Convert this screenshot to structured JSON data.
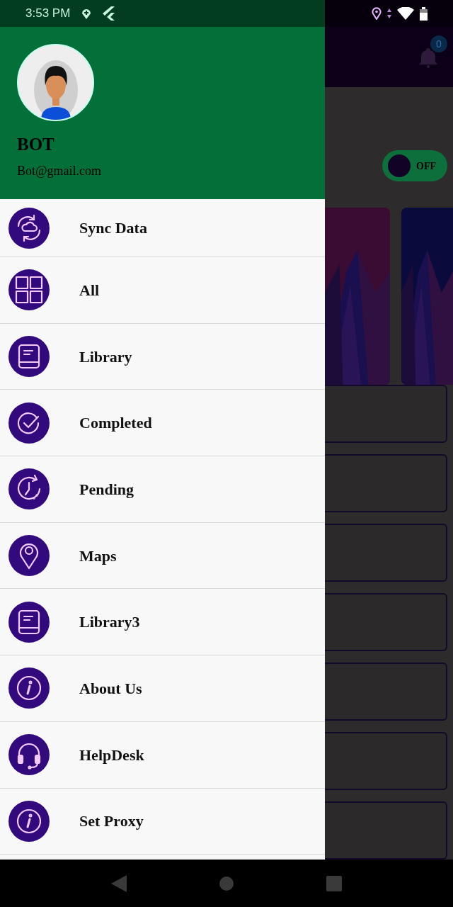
{
  "status_bar": {
    "time": "3:53 PM"
  },
  "drawer": {
    "profile": {
      "name": "BOT",
      "email": "Bot@gmail.com"
    },
    "items": [
      {
        "label": "Sync Data",
        "kind": "sync"
      },
      {
        "label": "All",
        "kind": "grid"
      },
      {
        "label": "Library",
        "kind": "book"
      },
      {
        "label": "Completed",
        "kind": "check"
      },
      {
        "label": "Pending",
        "kind": "clock"
      },
      {
        "label": "Maps",
        "kind": "pin"
      },
      {
        "label": "Library3",
        "kind": "book"
      },
      {
        "label": "About Us",
        "kind": "info"
      },
      {
        "label": "HelpDesk",
        "kind": "headset"
      },
      {
        "label": "Set Proxy",
        "kind": "info"
      }
    ]
  },
  "background_app": {
    "notification_badge": "0",
    "toggle": {
      "label": "OFF",
      "on": false
    }
  }
}
